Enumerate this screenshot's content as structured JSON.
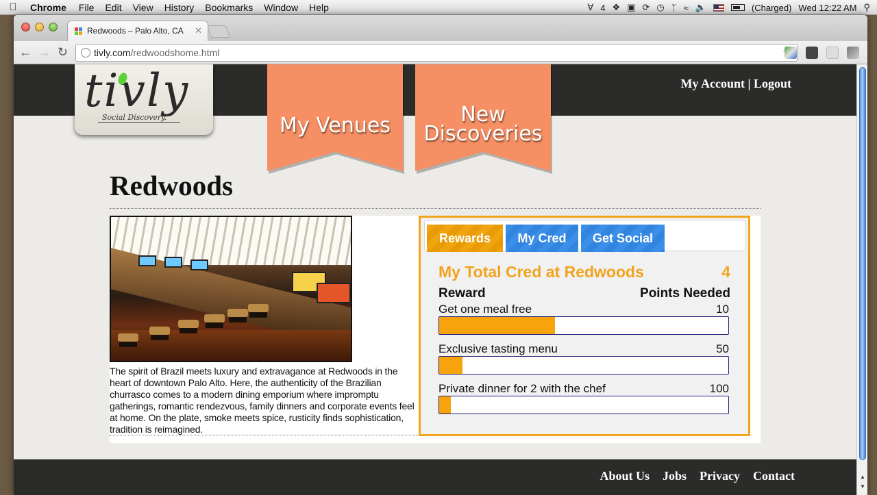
{
  "menubar": {
    "app_name": "Chrome",
    "items": [
      "File",
      "Edit",
      "View",
      "History",
      "Bookmarks",
      "Window",
      "Help"
    ],
    "indicator_count": "4",
    "battery_status": "(Charged)",
    "clock": "Wed 12:22 AM"
  },
  "browser": {
    "tab_title": "Redwoods – Palo Alto, CA",
    "url_host": "tivly.com",
    "url_path": "/redwoodshome.html"
  },
  "site": {
    "logo_text": "tivly",
    "logo_tagline": "Social Discovery.",
    "nav": {
      "my_venues": "My Venues",
      "new_discoveries_line1": "New",
      "new_discoveries_line2": "Discoveries"
    },
    "account": {
      "my_account": "My Account",
      "separator": "|",
      "logout": "Logout"
    }
  },
  "venue": {
    "name": "Redwoods",
    "description": "The spirit of Brazil meets luxury and extravagance at Redwoods in the heart of downtown Palo Alto. Here, the authenticity of the Brazilian churrasco comes to a modern dining emporium where impromptu gatherings, romantic rendezvous, family dinners and corporate events feel at home. On the plate, smoke meets spice, rusticity finds sophistication, tradition is reimagined."
  },
  "rewards_widget": {
    "tabs": [
      "Rewards",
      "My Cred",
      "Get Social"
    ],
    "active_tab": "Rewards",
    "total_label": "My Total Cred at Redwoods",
    "total_value": "4",
    "header_reward": "Reward",
    "header_points": "Points Needed",
    "rewards": [
      {
        "name": "Get one meal free",
        "points": "10",
        "progress": 0.4
      },
      {
        "name": "Exclusive tasting menu",
        "points": "50",
        "progress": 0.08
      },
      {
        "name": "Private dinner for 2 with the chef",
        "points": "100",
        "progress": 0.04
      }
    ]
  },
  "footer": {
    "links": [
      "About Us",
      "Jobs",
      "Privacy",
      "Contact"
    ]
  },
  "colors": {
    "accent_orange": "#f2a31d",
    "ribbon": "#f68f63",
    "tab_blue": "#3b8fe8",
    "header_dark": "#2b2b2a"
  }
}
